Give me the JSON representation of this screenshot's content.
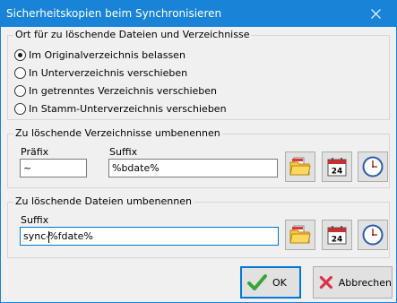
{
  "window": {
    "title": "Sicherheitskopien beim Synchronisieren"
  },
  "location_group": {
    "legend": "Ort für zu löschende Dateien und Verzeichnisse",
    "options": [
      {
        "label": "Im Originalverzeichnis belassen",
        "selected": true
      },
      {
        "label": "In Unterverzeichnis verschieben",
        "selected": false
      },
      {
        "label": "In getrenntes Verzeichnis verschieben",
        "selected": false
      },
      {
        "label": "In Stamm-Unterverzeichnis verschieben",
        "selected": false
      }
    ]
  },
  "dirs_group": {
    "legend": "Zu löschende Verzeichnisse umbenennen",
    "prefix_label": "Präfix",
    "prefix_value": "~",
    "suffix_label": "Suffix",
    "suffix_value": "%bdate%"
  },
  "files_group": {
    "legend": "Zu löschende Dateien umbenennen",
    "suffix_label": "Suffix",
    "suffix_value_before_caret": "sync-",
    "suffix_value_after_caret": "%fdate%"
  },
  "calendar_icon_text": "24",
  "buttons": {
    "ok": "OK",
    "cancel": "Abbrechen"
  },
  "colors": {
    "titlebar": "#1883d7",
    "accent": "#0078d7",
    "ok_check": "#3aa33a",
    "cancel_x": "#d9324b"
  }
}
